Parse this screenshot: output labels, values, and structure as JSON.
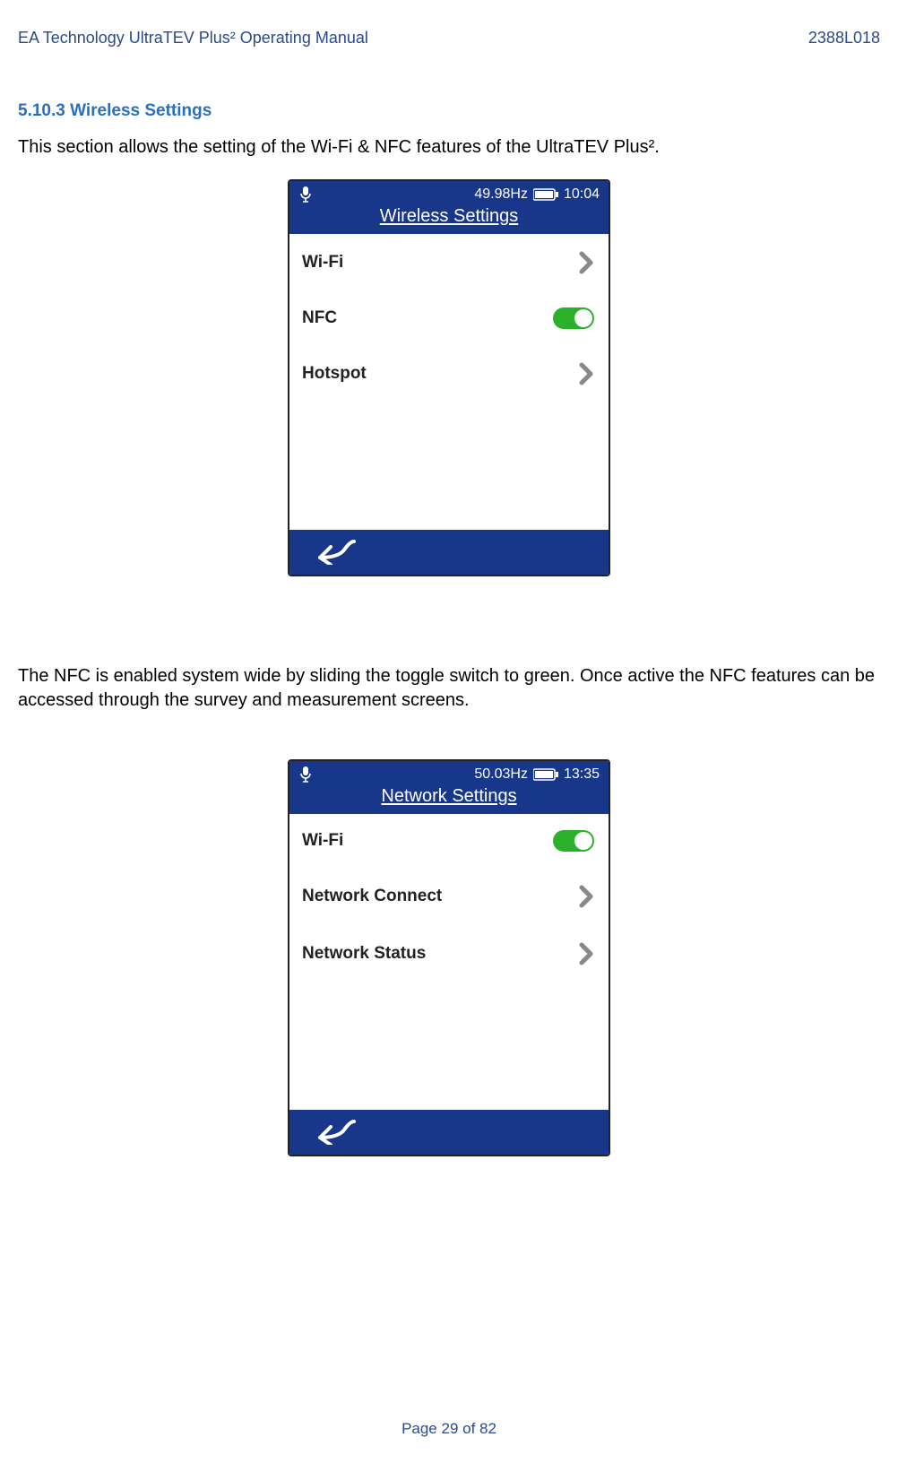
{
  "doc": {
    "header_left": "EA Technology UltraTEV Plus² Operating Manual",
    "header_right": "2388L018",
    "footer": "Page 29 of 82"
  },
  "section": {
    "heading": "5.10.3 Wireless Settings",
    "intro": "This section allows the setting of the Wi-Fi & NFC features of the UltraTEV Plus².",
    "nfc_para": "The NFC is enabled system wide by sliding the toggle switch to green. Once active the NFC features can be accessed through the survey and measurement screens."
  },
  "screen1": {
    "status": {
      "freq": "49.98Hz",
      "time": "10:04"
    },
    "title": "Wireless Settings",
    "items": {
      "wifi": "Wi-Fi",
      "nfc": "NFC",
      "hotspot": "Hotspot"
    }
  },
  "screen2": {
    "status": {
      "freq": "50.03Hz",
      "time": "13:35"
    },
    "title": "Network Settings",
    "items": {
      "wifi": "Wi-Fi",
      "connect": "Network Connect",
      "status_label": "Network Status"
    }
  }
}
